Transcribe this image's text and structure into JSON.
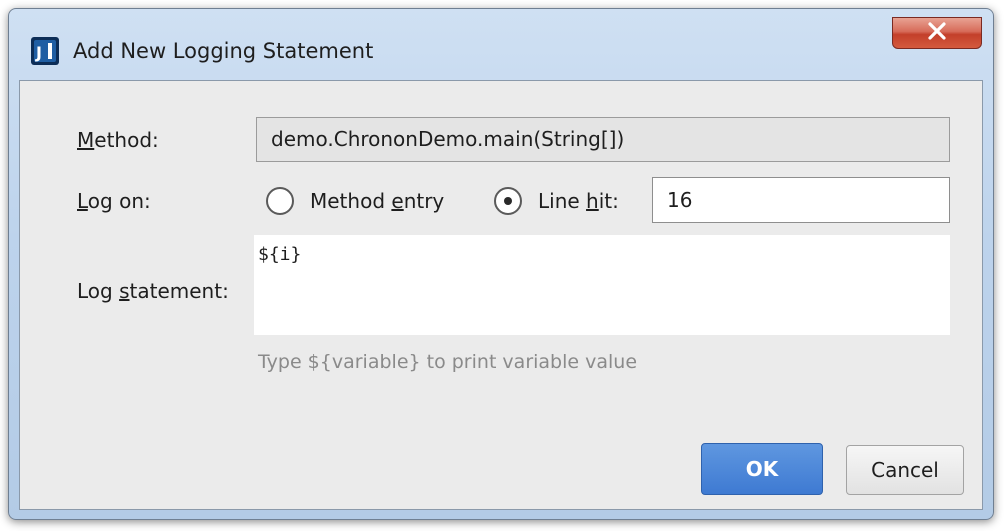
{
  "window": {
    "title": "Add New Logging Statement",
    "app_icon": "intellij-idea-icon",
    "close_icon": "close-x-icon"
  },
  "form": {
    "method_label_pre": "",
    "method_label_ul": "M",
    "method_label_post": "ethod:",
    "method_value": "demo.ChrononDemo.main(String[])",
    "logon_label_pre": "",
    "logon_label_ul": "L",
    "logon_label_post": "og on:",
    "radio_method_entry_pre": "Method ",
    "radio_method_entry_ul": "e",
    "radio_method_entry_post": "ntry",
    "radio_line_hit_pre": "Line ",
    "radio_line_hit_ul": "h",
    "radio_line_hit_post": "it:",
    "selected_option": "line_hit",
    "line_hit_value": "16",
    "log_statement_label_pre": "Log ",
    "log_statement_label_ul": "s",
    "log_statement_label_post": "tatement:",
    "log_statement_value": "${i}",
    "hint": "Type ${variable} to print variable value"
  },
  "buttons": {
    "ok_label": "OK",
    "cancel_label": "Cancel"
  },
  "colors": {
    "ok_accent": "#3e7ad2",
    "close_button": "#c33f2a"
  }
}
